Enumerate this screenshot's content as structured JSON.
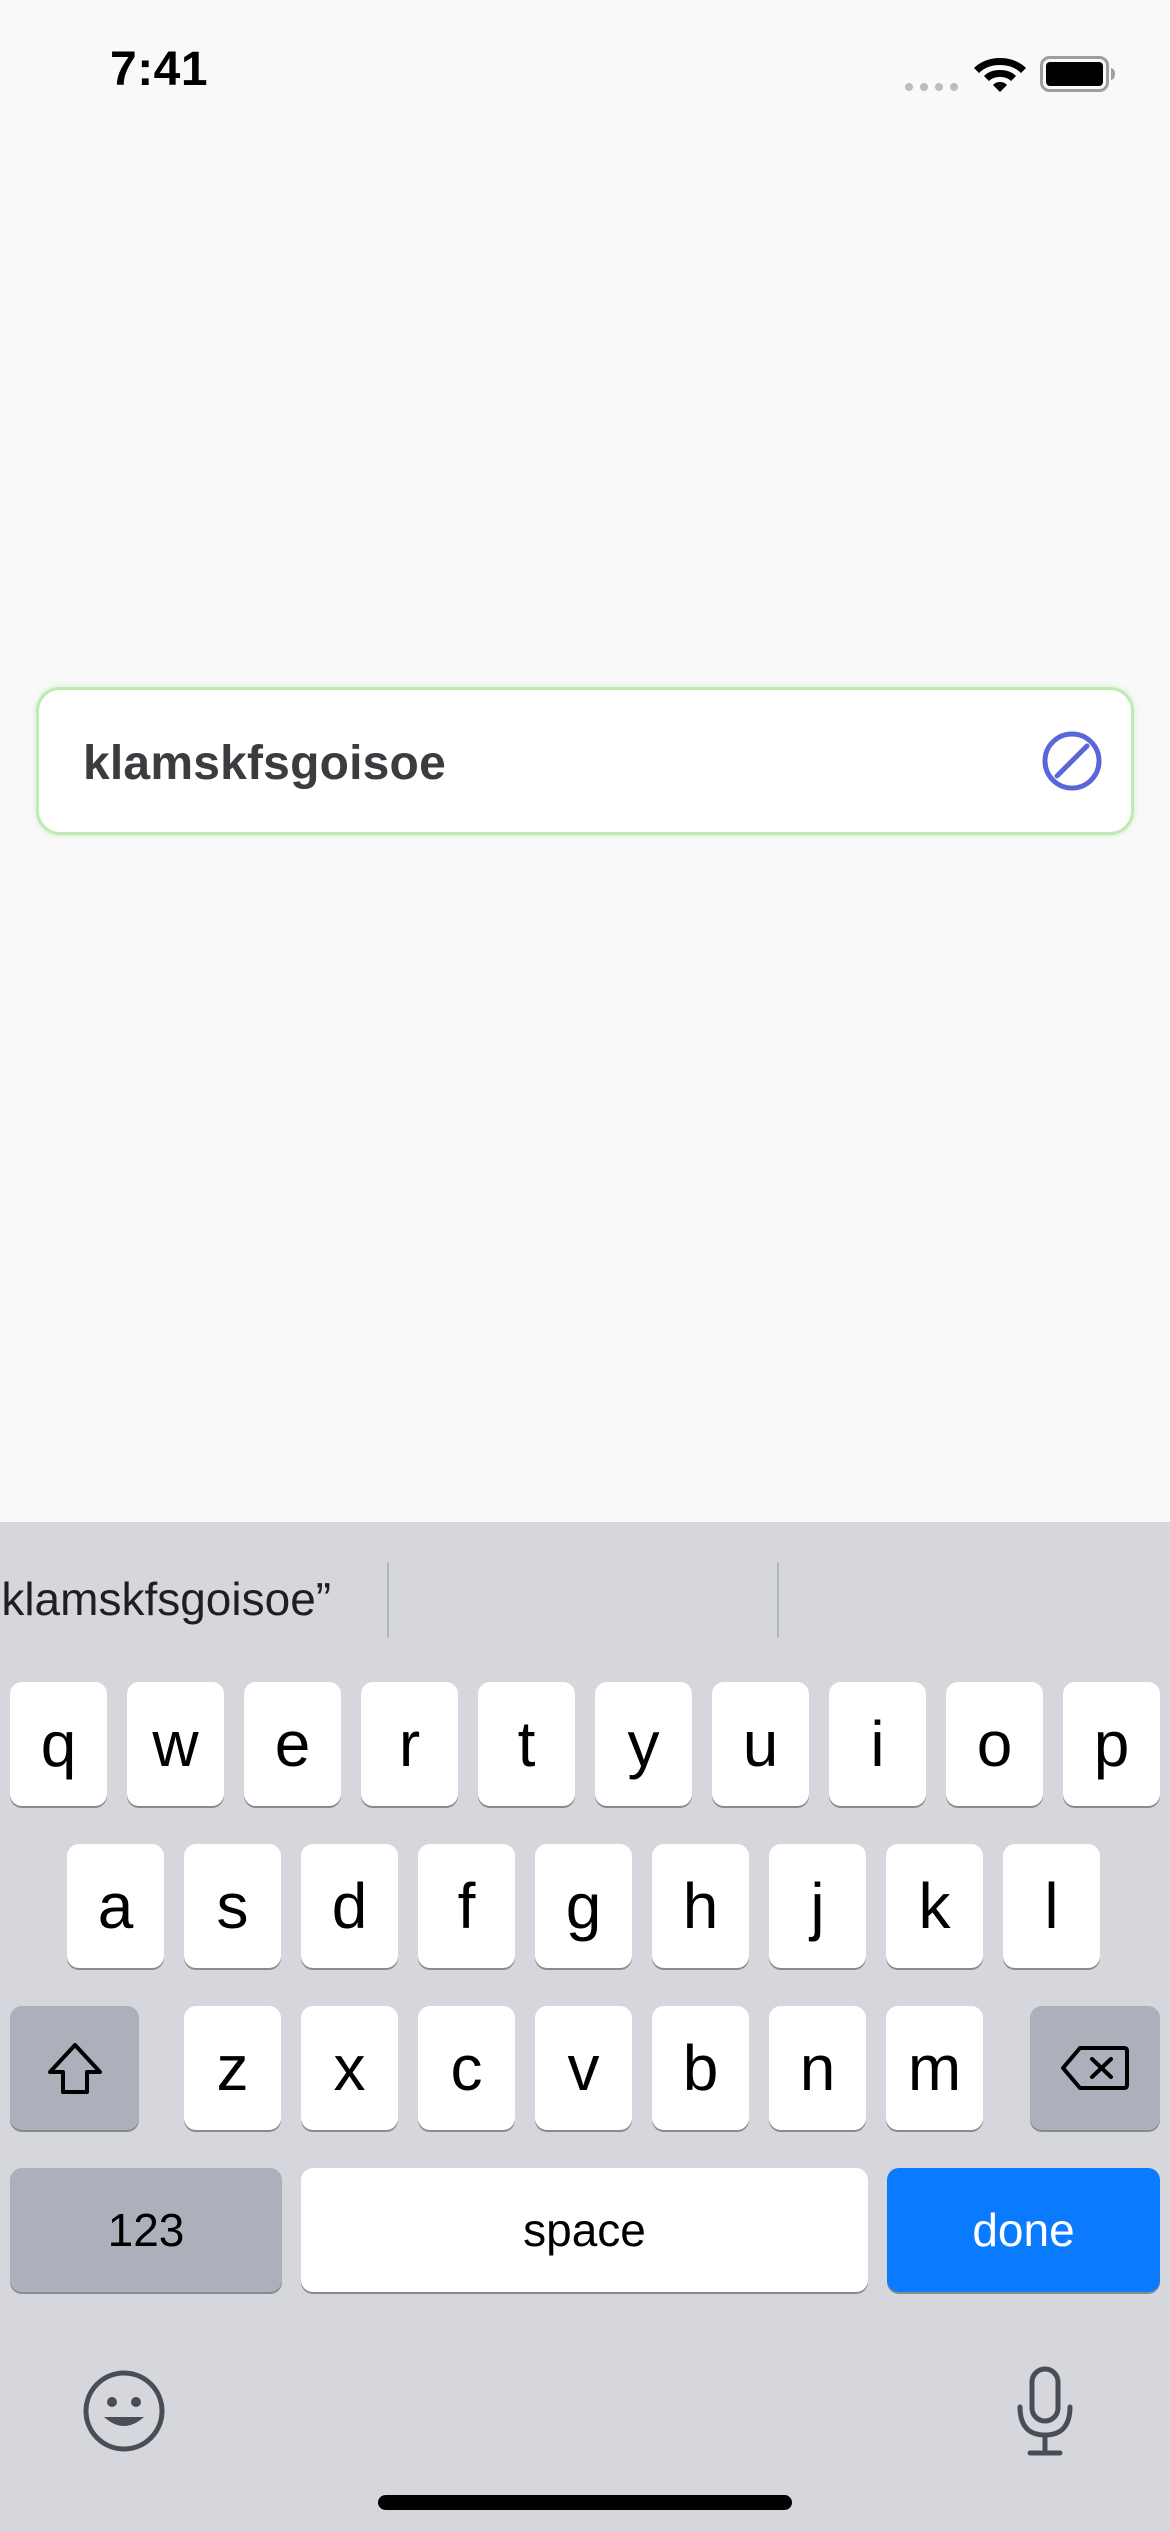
{
  "status_bar": {
    "time": "7:41"
  },
  "input": {
    "value": "klamskfsgoisoe",
    "border_color": "#BDEBB0",
    "clear_icon": "slash-circle-icon",
    "clear_icon_color": "#5A67D8"
  },
  "keyboard": {
    "suggestions": [
      "“klamskfsgoisoe”",
      "",
      ""
    ],
    "row1": [
      "q",
      "w",
      "e",
      "r",
      "t",
      "y",
      "u",
      "i",
      "o",
      "p"
    ],
    "row2": [
      "a",
      "s",
      "d",
      "f",
      "g",
      "h",
      "j",
      "k",
      "l"
    ],
    "row3": [
      "z",
      "x",
      "c",
      "v",
      "b",
      "n",
      "m"
    ],
    "numbers_label": "123",
    "space_label": "space",
    "done_label": "done",
    "shift_icon": "shift-icon",
    "delete_icon": "delete-icon",
    "emoji_icon": "emoji-icon",
    "mic_icon": "microphone-icon",
    "accent_color": "#0A7AFF"
  }
}
